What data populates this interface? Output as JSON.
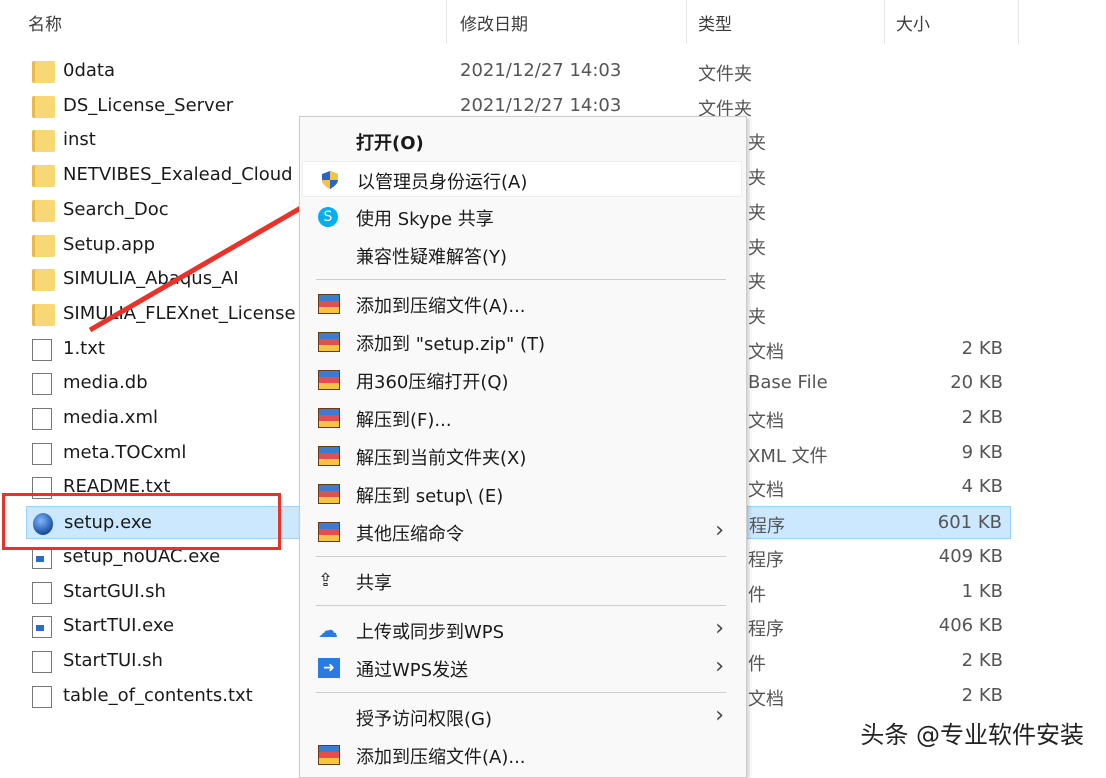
{
  "header": {
    "name": "名称",
    "date": "修改日期",
    "type": "类型",
    "size": "大小",
    "sort_icon": "chevron-up-icon"
  },
  "files": [
    {
      "name": "0data",
      "date": "2021/12/27 14:03",
      "type": "文件夹",
      "size": "",
      "icon": "folder"
    },
    {
      "name": "DS_License_Server",
      "date": "2021/12/27 14:03",
      "type": "文件夹",
      "size": "",
      "icon": "folder"
    },
    {
      "name": "inst",
      "date": "",
      "type": "夹",
      "size": "",
      "icon": "folder"
    },
    {
      "name": "NETVIBES_Exalead_Cloud",
      "date": "",
      "type": "夹",
      "size": "",
      "icon": "folder"
    },
    {
      "name": "Search_Doc",
      "date": "",
      "type": "夹",
      "size": "",
      "icon": "folder"
    },
    {
      "name": "Setup.app",
      "date": "",
      "type": "夹",
      "size": "",
      "icon": "folder"
    },
    {
      "name": "SIMULIA_Abaqus_AI",
      "date": "",
      "type": "夹",
      "size": "",
      "icon": "folder"
    },
    {
      "name": "SIMULIA_FLEXnet_License",
      "date": "",
      "type": "夹",
      "size": "",
      "icon": "folder"
    },
    {
      "name": "1.txt",
      "date": "",
      "type": "文档",
      "size": "2 KB",
      "icon": "doc"
    },
    {
      "name": "media.db",
      "date": "",
      "type": "Base File",
      "size": "20 KB",
      "icon": "doc"
    },
    {
      "name": "media.xml",
      "date": "",
      "type": "文档",
      "size": "2 KB",
      "icon": "doc"
    },
    {
      "name": "meta.TOCxml",
      "date": "",
      "type": "XML 文件",
      "size": "9 KB",
      "icon": "doc"
    },
    {
      "name": "README.txt",
      "date": "",
      "type": "文档",
      "size": "4 KB",
      "icon": "doc"
    },
    {
      "name": "setup.exe",
      "date": "",
      "type": "程序",
      "size": "601 KB",
      "icon": "globe",
      "selected": true
    },
    {
      "name": "setup_noUAC.exe",
      "date": "",
      "type": "程序",
      "size": "409 KB",
      "icon": "exe"
    },
    {
      "name": "StartGUI.sh",
      "date": "",
      "type": "件",
      "size": "1 KB",
      "icon": "doc"
    },
    {
      "name": "StartTUI.exe",
      "date": "",
      "type": "程序",
      "size": "406 KB",
      "icon": "exe"
    },
    {
      "name": "StartTUI.sh",
      "date": "",
      "type": "件",
      "size": "2 KB",
      "icon": "doc"
    },
    {
      "name": "table_of_contents.txt",
      "date": "",
      "type": "文档",
      "size": "2 KB",
      "icon": "doc"
    }
  ],
  "menu": [
    {
      "label": "打开(O)",
      "icon": "",
      "bold": true
    },
    {
      "label": "以管理员身份运行(A)",
      "icon": "shield",
      "hl": true
    },
    {
      "label": "使用 Skype 共享",
      "icon": "skype"
    },
    {
      "label": "兼容性疑难解答(Y)",
      "icon": "",
      "sep_after": true
    },
    {
      "label": "添加到压缩文件(A)...",
      "icon": "rar"
    },
    {
      "label": "添加到 \"setup.zip\" (T)",
      "icon": "rar"
    },
    {
      "label": "用360压缩打开(Q)",
      "icon": "rar"
    },
    {
      "label": "解压到(F)...",
      "icon": "rar"
    },
    {
      "label": "解压到当前文件夹(X)",
      "icon": "rar"
    },
    {
      "label": "解压到 setup\\ (E)",
      "icon": "rar"
    },
    {
      "label": "其他压缩命令",
      "icon": "rar",
      "submenu": true,
      "sep_after": true
    },
    {
      "label": "共享",
      "icon": "share",
      "sep_after": true
    },
    {
      "label": "上传或同步到WPS",
      "icon": "cloud",
      "submenu": true
    },
    {
      "label": "通过WPS发送",
      "icon": "wps-send",
      "submenu": true,
      "sep_after": true
    },
    {
      "label": "授予访问权限(G)",
      "icon": "",
      "submenu": true
    },
    {
      "label": "添加到压缩文件(A)...",
      "icon": "winrar"
    }
  ],
  "watermark": "头条 @专业软件安装",
  "colors": {
    "selection": "#cce8ff",
    "annotation": "#e8322a"
  }
}
